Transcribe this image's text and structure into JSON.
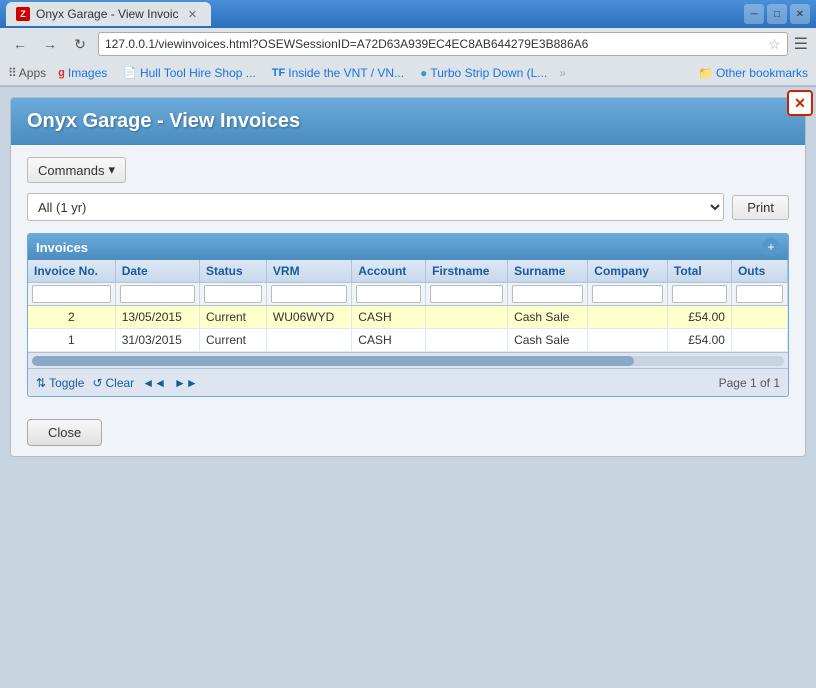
{
  "browser": {
    "tab_title": "Onyx Garage - View Invoic",
    "url": "127.0.0.1/viewinvoices.html?OSEWSessionID=A72D63A939EC4EC8AB644279E3B886A6",
    "bookmarks": {
      "apps_label": "Apps",
      "items": [
        {
          "label": "Images",
          "icon": "g"
        },
        {
          "label": "Hull Tool Hire Shop ...",
          "icon": "doc"
        },
        {
          "label": "Inside the VNT / VN...",
          "icon": "tf"
        },
        {
          "label": "Turbo Strip Down (L...",
          "icon": "blue-dot"
        }
      ],
      "more_label": "»",
      "other_label": "Other bookmarks"
    }
  },
  "page": {
    "title": "Onyx Garage - View Invoices",
    "commands_label": "Commands",
    "filter_options": [
      {
        "value": "all_1yr",
        "label": "All (1 yr)"
      }
    ],
    "filter_selected": "All (1 yr)",
    "print_label": "Print",
    "table": {
      "section_label": "Invoices",
      "columns": [
        {
          "key": "invoice_no",
          "label": "Invoice No."
        },
        {
          "key": "date",
          "label": "Date"
        },
        {
          "key": "status",
          "label": "Status"
        },
        {
          "key": "vrm",
          "label": "VRM"
        },
        {
          "key": "account",
          "label": "Account"
        },
        {
          "key": "firstname",
          "label": "Firstname"
        },
        {
          "key": "surname",
          "label": "Surname"
        },
        {
          "key": "company",
          "label": "Company"
        },
        {
          "key": "total",
          "label": "Total"
        },
        {
          "key": "outstanding",
          "label": "Outs"
        }
      ],
      "rows": [
        {
          "invoice_no": "2",
          "date": "13/05/2015",
          "status": "Current",
          "vrm": "WU06WYD",
          "account": "CASH",
          "firstname": "",
          "surname": "Cash Sale",
          "company": "",
          "total": "£54.00",
          "outstanding": "",
          "style": "yellow"
        },
        {
          "invoice_no": "1",
          "date": "31/03/2015",
          "status": "Current",
          "vrm": "",
          "account": "CASH",
          "firstname": "",
          "surname": "Cash Sale",
          "company": "",
          "total": "£54.00",
          "outstanding": "",
          "style": "white"
        }
      ]
    },
    "toolbar": {
      "toggle_label": "Toggle",
      "clear_label": "Clear",
      "prev_label": "◄◄",
      "next_label": "►►",
      "page_info": "Page 1 of 1"
    },
    "close_label": "Close"
  }
}
